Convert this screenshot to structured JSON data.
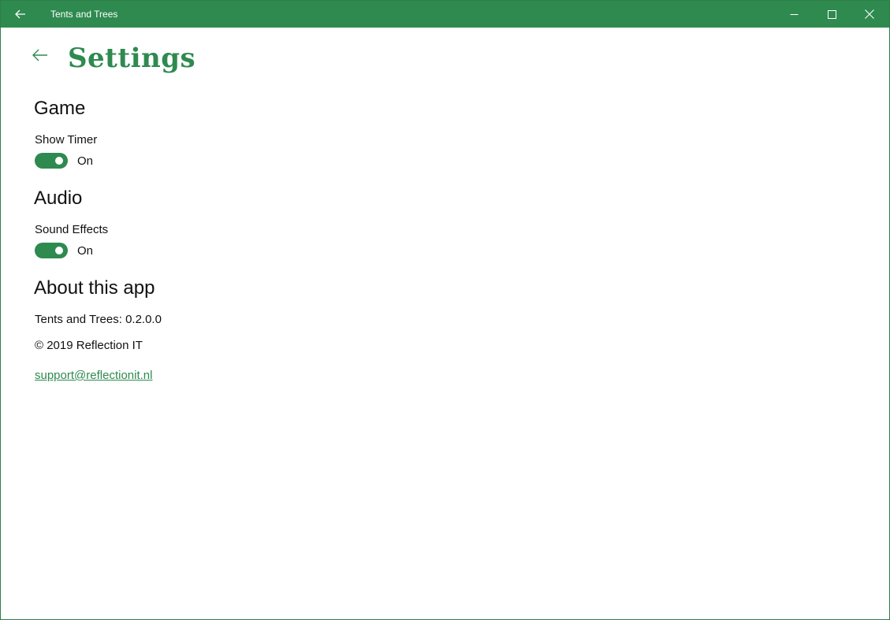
{
  "window": {
    "title": "Tents and Trees"
  },
  "page": {
    "title": "Settings"
  },
  "sections": {
    "game": {
      "header": "Game",
      "show_timer": {
        "label": "Show Timer",
        "state": "On"
      }
    },
    "audio": {
      "header": "Audio",
      "sound_effects": {
        "label": "Sound Effects",
        "state": "On"
      }
    },
    "about": {
      "header": "About this app",
      "version": "Tents and Trees: 0.2.0.0",
      "copyright": "© 2019 Reflection IT",
      "support_email": "support@reflectionit.nl"
    }
  },
  "colors": {
    "accent": "#2e8a4f",
    "background": "#ffffff",
    "text": "#111111"
  },
  "icons": {
    "titlebar_back": "arrow-left-icon",
    "page_back": "arrow-left-icon",
    "minimize": "minimize-icon",
    "maximize": "maximize-icon",
    "close": "close-icon"
  }
}
